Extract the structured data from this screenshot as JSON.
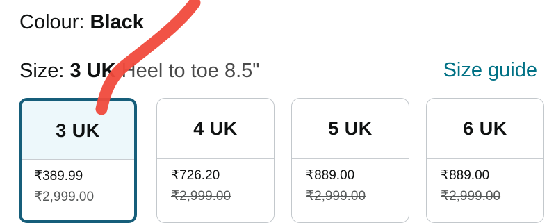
{
  "colour": {
    "label": "Colour: ",
    "value": "Black"
  },
  "size": {
    "label": "Size: ",
    "value": "3 UK",
    "detail": "Heel to toe 8.5\""
  },
  "size_guide": "Size guide",
  "tiles": [
    {
      "size": "3 UK",
      "price": "₹389.99",
      "mrp": "₹2,999.00",
      "selected": true
    },
    {
      "size": "4 UK",
      "price": "₹726.20",
      "mrp": "₹2,999.00",
      "selected": false
    },
    {
      "size": "5 UK",
      "price": "₹889.00",
      "mrp": "₹2,999.00",
      "selected": false
    },
    {
      "size": "6 UK",
      "price": "₹889.00",
      "mrp": "₹2,999.00",
      "selected": false
    }
  ],
  "colors": {
    "link": "#007185",
    "selected_border": "#165e7a",
    "annotation_stroke": "#f04a3c"
  }
}
